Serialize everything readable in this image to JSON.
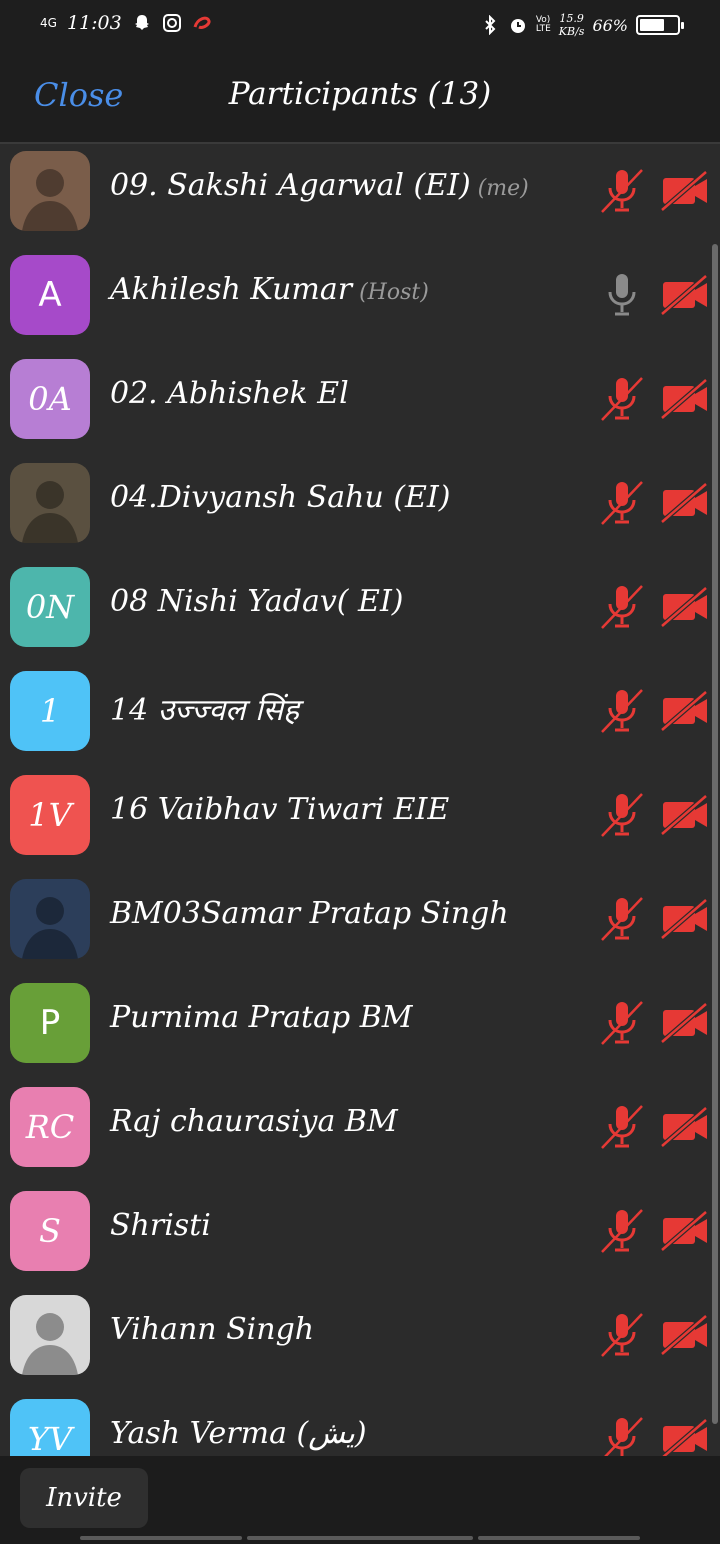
{
  "status_bar": {
    "network": "4G",
    "time": "11:03",
    "speed_top": "15.9",
    "speed_unit": "KB/s",
    "battery": "66%",
    "battery_fraction": 0.66
  },
  "header": {
    "close_label": "Close",
    "title": "Participants (13)"
  },
  "colors": {
    "close": "#4a8ee8",
    "muted_red": "#e63935",
    "mic_gray": "#8a8a8a"
  },
  "participants": [
    {
      "name": "09. Sakshi Agarwal (EI)",
      "tag": "(me)",
      "avatar_type": "photo",
      "avatar_text": "",
      "avatar_color": "#7a5d4a",
      "mic": "muted",
      "video": "off"
    },
    {
      "name": "Akhilesh Kumar",
      "tag": "(Host)",
      "avatar_type": "letter",
      "avatar_text": "A",
      "avatar_color": "#a64ac9",
      "mic": "on",
      "video": "off"
    },
    {
      "name": "02. Abhishek El",
      "tag": "",
      "avatar_type": "initials",
      "avatar_text": "0A",
      "avatar_color": "#b77ed4",
      "mic": "muted",
      "video": "off"
    },
    {
      "name": "04.Divyansh Sahu (EI)",
      "tag": "",
      "avatar_type": "photo",
      "avatar_text": "",
      "avatar_color": "#5a5040",
      "mic": "muted",
      "video": "off"
    },
    {
      "name": "08 Nishi Yadav( EI)",
      "tag": "",
      "avatar_type": "initials",
      "avatar_text": "0N",
      "avatar_color": "#4db6ac",
      "mic": "muted",
      "video": "off"
    },
    {
      "name": "14 उज्ज्वल सिंह",
      "tag": "",
      "avatar_type": "initials",
      "avatar_text": "1",
      "avatar_color": "#4fc3f7",
      "mic": "muted",
      "video": "off"
    },
    {
      "name": "16 Vaibhav Tiwari EIE",
      "tag": "",
      "avatar_type": "initials",
      "avatar_text": "1V",
      "avatar_color": "#ef5350",
      "mic": "muted",
      "video": "off"
    },
    {
      "name": "BM03Samar Pratap Singh",
      "tag": "",
      "avatar_type": "photo",
      "avatar_text": "",
      "avatar_color": "#2c3e5a",
      "mic": "muted",
      "video": "off"
    },
    {
      "name": "Purnima Pratap BM",
      "tag": "",
      "avatar_type": "letter",
      "avatar_text": "P",
      "avatar_color": "#689f38",
      "mic": "muted",
      "video": "off"
    },
    {
      "name": "Raj chaurasiya BM",
      "tag": "",
      "avatar_type": "initials",
      "avatar_text": "RC",
      "avatar_color": "#e87fb0",
      "mic": "muted",
      "video": "off"
    },
    {
      "name": "Shristi",
      "tag": "",
      "avatar_type": "initials",
      "avatar_text": "S",
      "avatar_color": "#e87fb0",
      "mic": "muted",
      "video": "off"
    },
    {
      "name": "Vihann Singh",
      "tag": "",
      "avatar_type": "photo",
      "avatar_text": "",
      "avatar_color": "#d8d8d8",
      "mic": "muted",
      "video": "off"
    },
    {
      "name": "Yash Verma (يش)",
      "tag": "",
      "avatar_type": "initials",
      "avatar_text": "YV",
      "avatar_color": "#4fc3f7",
      "mic": "muted",
      "video": "off"
    }
  ],
  "footer": {
    "invite_label": "Invite"
  }
}
